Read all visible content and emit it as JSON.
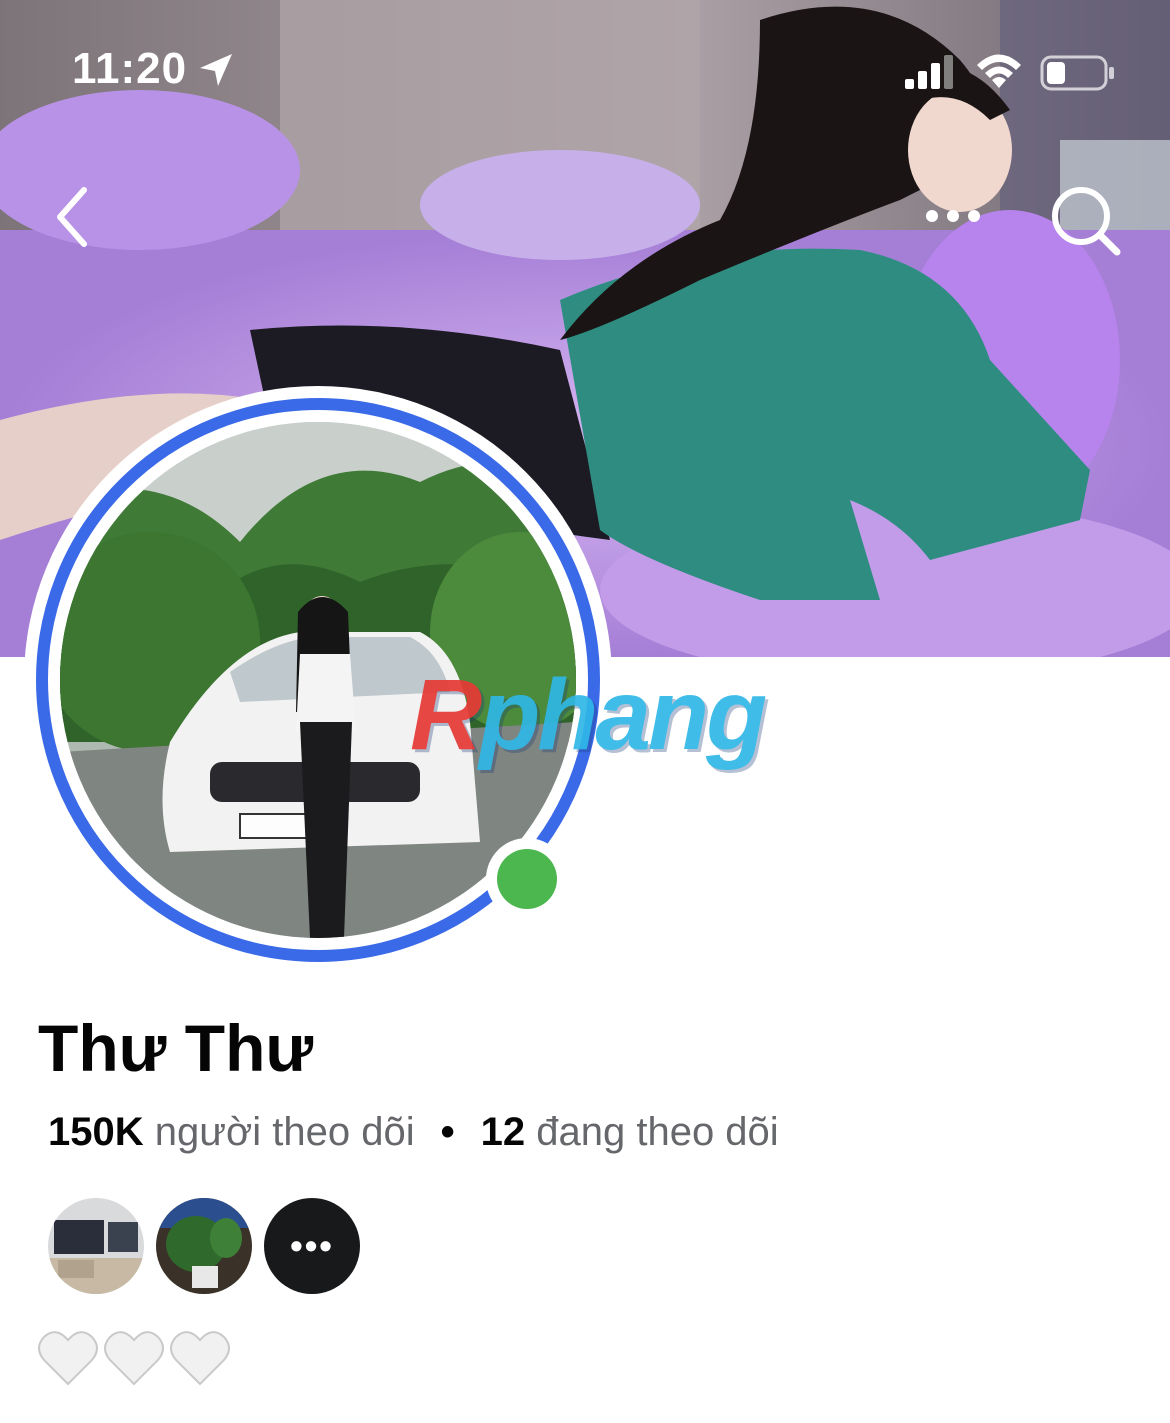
{
  "status_bar": {
    "time": "11:20",
    "location_icon": "location-arrow-icon",
    "signal_icon": "cellular-signal-icon",
    "wifi_icon": "wifi-icon",
    "battery_icon": "battery-icon"
  },
  "nav": {
    "back_icon": "chevron-left-icon",
    "more_icon": "more-dots-icon",
    "search_icon": "search-icon"
  },
  "profile": {
    "name": "Thư Thư",
    "followers_count": "150K",
    "followers_label": "người theo dõi",
    "separator": "•",
    "following_count": "12",
    "following_label": "đang theo dõi",
    "online": true
  },
  "friends_more_label": "•••",
  "watermark": {
    "first": "R",
    "rest": "phang"
  },
  "hearts": [
    "🤍",
    "🤍",
    "🤍"
  ],
  "colors": {
    "story_ring": "#3a6ae8",
    "online": "#4cb64f",
    "cover_purple": "#b98fe0"
  }
}
